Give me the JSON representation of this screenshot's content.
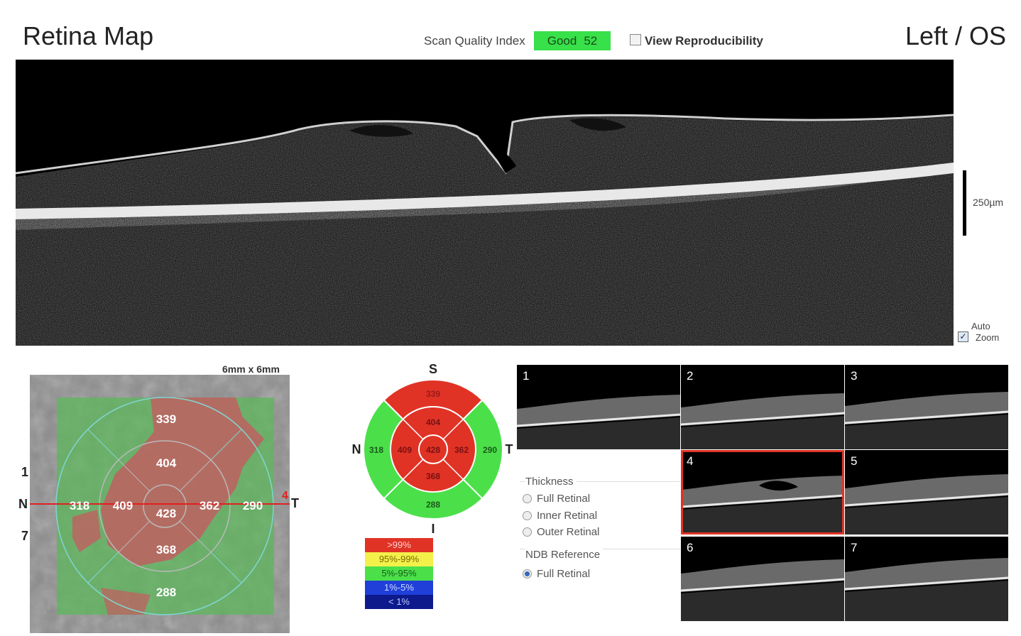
{
  "header": {
    "title": "Retina Map",
    "scan_quality_label": "Scan Quality Index",
    "scan_quality_status": "Good",
    "scan_quality_value": "52",
    "view_reproducibility_label": "View Reproducibility",
    "eye": "Left / OS"
  },
  "bscan": {
    "scale_label": "250µm",
    "auto_zoom_line1": "Auto",
    "auto_zoom_line2": "Zoom",
    "auto_zoom_checked": true
  },
  "fundus": {
    "dimension": "6mm x 6mm",
    "row_labels": [
      "1",
      "N",
      "7"
    ],
    "temporal_label": "T",
    "line_number": "4",
    "values": {
      "superior_outer": "339",
      "superior_inner": "404",
      "nasal_outer": "318",
      "nasal_inner": "409",
      "center": "428",
      "temporal_inner": "362",
      "temporal_outer": "290",
      "inferior_inner": "368",
      "inferior_outer": "288"
    }
  },
  "etdrs": {
    "labels": {
      "S": "S",
      "I": "I",
      "N": "N",
      "T": "T"
    },
    "values": {
      "superior_outer": "339",
      "superior_inner": "404",
      "nasal_outer": "318",
      "nasal_inner": "409",
      "center": "428",
      "temporal_inner": "362",
      "temporal_outer": "290",
      "inferior_inner": "368",
      "inferior_outer": "288"
    },
    "colors": {
      "red": "#e03326",
      "green": "#4be04a",
      "yellow": "#f4f04a",
      "blue": "#1f3fd8",
      "navy": "#0c1a8c"
    }
  },
  "legend": [
    {
      "label": ">99%",
      "color": "#e03326"
    },
    {
      "label": "95%-99%",
      "color": "#f4f04a"
    },
    {
      "label": "5%-95%",
      "color": "#4be04a"
    },
    {
      "label": "1%-5%",
      "color": "#1f3fd8"
    },
    {
      "label": "< 1%",
      "color": "#0c1a8c"
    }
  ],
  "thumbnails": [
    {
      "num": "1",
      "selected": false
    },
    {
      "num": "2",
      "selected": false
    },
    {
      "num": "3",
      "selected": false
    },
    {
      "num": "4",
      "selected": true
    },
    {
      "num": "5",
      "selected": false
    },
    {
      "num": "6",
      "selected": false
    },
    {
      "num": "7",
      "selected": false
    }
  ],
  "options": {
    "thickness_heading": "Thickness",
    "thickness_options": [
      {
        "label": "Full Retinal",
        "selected": false
      },
      {
        "label": "Inner Retinal",
        "selected": false
      },
      {
        "label": "Outer Retinal",
        "selected": false
      }
    ],
    "ndb_heading": "NDB Reference",
    "ndb_options": [
      {
        "label": "Full Retinal",
        "selected": true
      }
    ]
  }
}
